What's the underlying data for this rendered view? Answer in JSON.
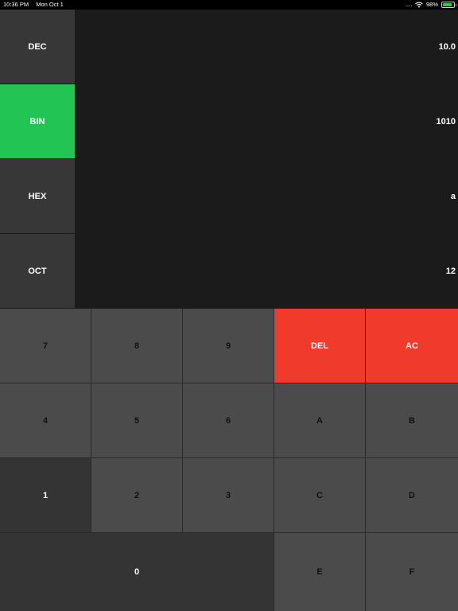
{
  "status_bar": {
    "time": "10:36 PM",
    "date": "Mon Oct 1",
    "signal_dots": ".....",
    "battery_percent": "98%",
    "icons": [
      "wifi-icon",
      "battery-icon"
    ]
  },
  "bases": [
    {
      "label": "DEC",
      "value": "10.0",
      "active": false
    },
    {
      "label": "BIN",
      "value": "1010",
      "active": true
    },
    {
      "label": "HEX",
      "value": "a",
      "active": false
    },
    {
      "label": "OCT",
      "value": "12",
      "active": false
    }
  ],
  "keys": {
    "k7": "7",
    "k8": "8",
    "k9": "9",
    "del": "DEL",
    "ac": "AC",
    "k4": "4",
    "k5": "5",
    "k6": "6",
    "kA": "A",
    "kB": "B",
    "k1": "1",
    "k2": "2",
    "k3": "3",
    "kC": "C",
    "kD": "D",
    "k0": "0",
    "kE": "E",
    "kF": "F"
  },
  "colors": {
    "active_base": "#22c553",
    "delete_clear": "#ef3a2c",
    "key": "#4b4b4b",
    "key_dark": "#343434",
    "display_bg": "#1b1b1b"
  }
}
